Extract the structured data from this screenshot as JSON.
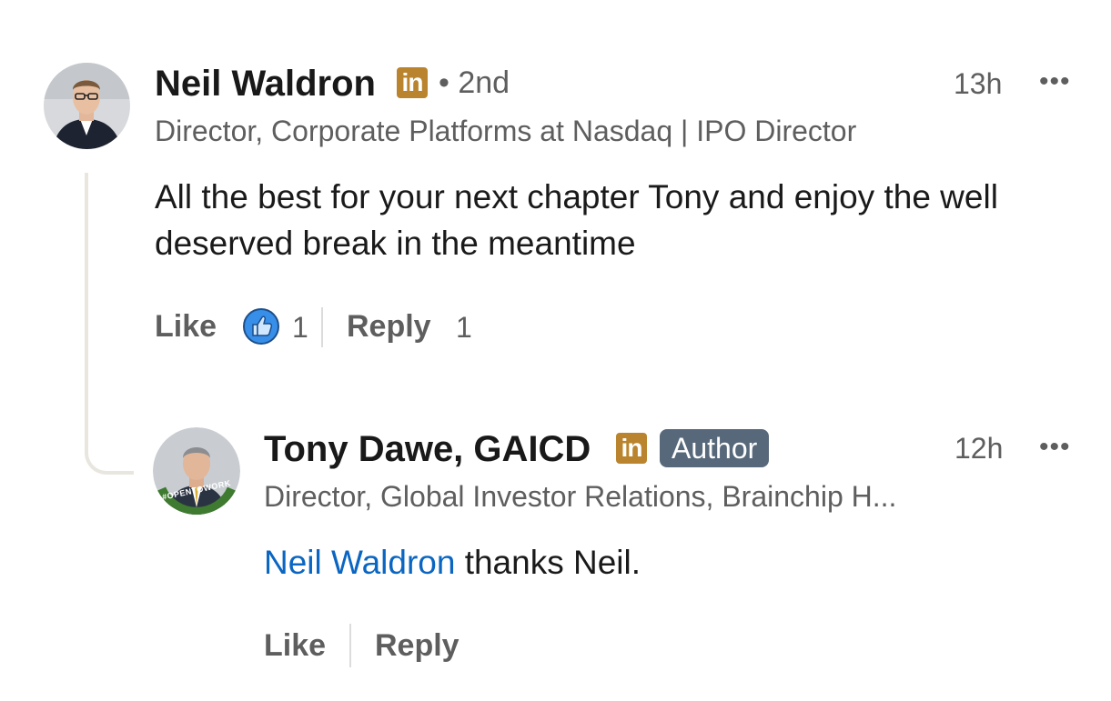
{
  "comment1": {
    "author_name": "Neil Waldron",
    "li_badge": "in",
    "degree": "• 2nd",
    "headline": "Director, Corporate Platforms at Nasdaq | IPO Director",
    "time": "13h",
    "more": "•••",
    "text": "All the best for your next chapter Tony and enjoy the well deserved break in the meantime",
    "actions": {
      "like_label": "Like",
      "like_count": "1",
      "reply_label": "Reply",
      "reply_count": "1"
    }
  },
  "comment2": {
    "author_name": "Tony Dawe, GAICD",
    "li_badge": "in",
    "author_badge": "Author",
    "headline": "Director, Global Investor Relations, Brainchip H...",
    "time": "12h",
    "more": "•••",
    "avatar_ring_text": "#OPENTOWORK",
    "mention": "Neil Waldron",
    "text": " thanks Neil.",
    "actions": {
      "like_label": "Like",
      "reply_label": "Reply"
    }
  },
  "colors": {
    "link": "#0a66c2",
    "li_badge": "#b9842d",
    "author_badge": "#56687a",
    "open_to_work": "#3e7a2f",
    "reaction_like": "#378fe9"
  },
  "icons": {
    "reaction": "thumbs-up-icon",
    "more": "more-horizontal-icon"
  }
}
